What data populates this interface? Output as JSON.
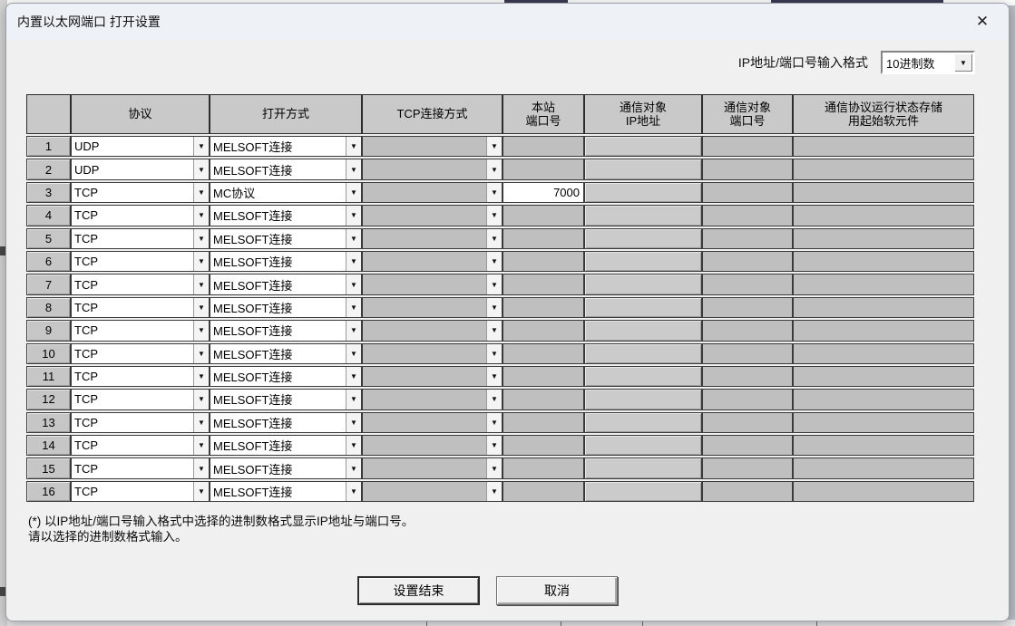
{
  "window": {
    "title": "内置以太网端口 打开设置"
  },
  "icons": {
    "close": "✕",
    "dropdown_arrow": "▼"
  },
  "format_selector": {
    "label": "IP地址/端口号输入格式",
    "value": "10进制数"
  },
  "table": {
    "columns": [
      {
        "id": "row_no",
        "lines": [
          ""
        ]
      },
      {
        "id": "protocol",
        "lines": [
          "协议"
        ]
      },
      {
        "id": "open_method",
        "lines": [
          "打开方式"
        ]
      },
      {
        "id": "tcp_mode",
        "lines": [
          "TCP连接方式"
        ]
      },
      {
        "id": "host_port",
        "lines": [
          "本站",
          "端口号"
        ]
      },
      {
        "id": "partner_ip",
        "lines": [
          "通信对象",
          "IP地址"
        ]
      },
      {
        "id": "partner_port",
        "lines": [
          "通信对象",
          "端口号"
        ]
      },
      {
        "id": "device",
        "lines": [
          "通信协议运行状态存储",
          "用起始软元件"
        ]
      }
    ],
    "rows": [
      {
        "no": "1",
        "protocol": "UDP",
        "open_method": "MELSOFT连接",
        "tcp_mode": "",
        "host_port": "",
        "partner_ip": "",
        "partner_port": "",
        "device": ""
      },
      {
        "no": "2",
        "protocol": "UDP",
        "open_method": "MELSOFT连接",
        "tcp_mode": "",
        "host_port": "",
        "partner_ip": "",
        "partner_port": "",
        "device": ""
      },
      {
        "no": "3",
        "protocol": "TCP",
        "open_method": "MC协议",
        "tcp_mode": "",
        "host_port": "7000",
        "partner_ip": "",
        "partner_port": "",
        "device": ""
      },
      {
        "no": "4",
        "protocol": "TCP",
        "open_method": "MELSOFT连接",
        "tcp_mode": "",
        "host_port": "",
        "partner_ip": "",
        "partner_port": "",
        "device": ""
      },
      {
        "no": "5",
        "protocol": "TCP",
        "open_method": "MELSOFT连接",
        "tcp_mode": "",
        "host_port": "",
        "partner_ip": "",
        "partner_port": "",
        "device": ""
      },
      {
        "no": "6",
        "protocol": "TCP",
        "open_method": "MELSOFT连接",
        "tcp_mode": "",
        "host_port": "",
        "partner_ip": "",
        "partner_port": "",
        "device": ""
      },
      {
        "no": "7",
        "protocol": "TCP",
        "open_method": "MELSOFT连接",
        "tcp_mode": "",
        "host_port": "",
        "partner_ip": "",
        "partner_port": "",
        "device": ""
      },
      {
        "no": "8",
        "protocol": "TCP",
        "open_method": "MELSOFT连接",
        "tcp_mode": "",
        "host_port": "",
        "partner_ip": "",
        "partner_port": "",
        "device": ""
      },
      {
        "no": "9",
        "protocol": "TCP",
        "open_method": "MELSOFT连接",
        "tcp_mode": "",
        "host_port": "",
        "partner_ip": "",
        "partner_port": "",
        "device": ""
      },
      {
        "no": "10",
        "protocol": "TCP",
        "open_method": "MELSOFT连接",
        "tcp_mode": "",
        "host_port": "",
        "partner_ip": "",
        "partner_port": "",
        "device": ""
      },
      {
        "no": "11",
        "protocol": "TCP",
        "open_method": "MELSOFT连接",
        "tcp_mode": "",
        "host_port": "",
        "partner_ip": "",
        "partner_port": "",
        "device": ""
      },
      {
        "no": "12",
        "protocol": "TCP",
        "open_method": "MELSOFT连接",
        "tcp_mode": "",
        "host_port": "",
        "partner_ip": "",
        "partner_port": "",
        "device": ""
      },
      {
        "no": "13",
        "protocol": "TCP",
        "open_method": "MELSOFT连接",
        "tcp_mode": "",
        "host_port": "",
        "partner_ip": "",
        "partner_port": "",
        "device": ""
      },
      {
        "no": "14",
        "protocol": "TCP",
        "open_method": "MELSOFT连接",
        "tcp_mode": "",
        "host_port": "",
        "partner_ip": "",
        "partner_port": "",
        "device": ""
      },
      {
        "no": "15",
        "protocol": "TCP",
        "open_method": "MELSOFT连接",
        "tcp_mode": "",
        "host_port": "",
        "partner_ip": "",
        "partner_port": "",
        "device": ""
      },
      {
        "no": "16",
        "protocol": "TCP",
        "open_method": "MELSOFT连接",
        "tcp_mode": "",
        "host_port": "",
        "partner_ip": "",
        "partner_port": "",
        "device": ""
      }
    ]
  },
  "footnote": {
    "line1": "(*) 以IP地址/端口号输入格式中选择的进制数格式显示IP地址与端口号。",
    "line2": "请以选择的进制数格式输入。"
  },
  "buttons": {
    "ok": "设置结束",
    "cancel": "取消"
  }
}
